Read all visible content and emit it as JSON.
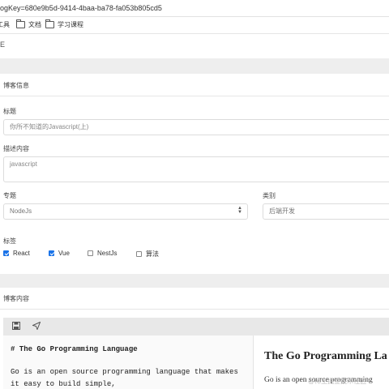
{
  "browser": {
    "url_fragment": "ogKey=680e9b5d-9414-4baa-ba78-fa053b805cd5",
    "bookmarks": [
      {
        "label": "工具",
        "icon": "folder-icon"
      },
      {
        "label": "文档",
        "icon": "folder-icon"
      },
      {
        "label": "学习课程",
        "icon": "folder-icon"
      }
    ]
  },
  "page": {
    "top_label": "E"
  },
  "form": {
    "section_title": "博客信息",
    "title_label": "标题",
    "title_value": "你所不知道的Javascript(上)",
    "desc_label": "描述内容",
    "desc_value": "javascript",
    "topic_label": "专题",
    "topic_value": "NodeJs",
    "category_label": "类别",
    "category_placeholder": "后端开发",
    "tags_label": "标签",
    "tags": [
      {
        "label": "React",
        "checked": true
      },
      {
        "label": "Vue",
        "checked": true
      },
      {
        "label": "NestJs",
        "checked": false
      },
      {
        "label": "算法",
        "checked": false
      }
    ]
  },
  "content": {
    "section_title": "博客内容",
    "toolbar": [
      {
        "icon": "save-icon"
      },
      {
        "icon": "send-icon"
      }
    ],
    "markdown_lines": [
      "# The Go Programming Language",
      "",
      "Go is an open source programming language that makes",
      "it easy to build simple,"
    ],
    "preview_heading": "The Go Programming La",
    "preview_paragraph": "Go is an open source programming"
  },
  "watermark": "@稀土掘金技术社区",
  "colors": {
    "accent": "#1a73e8",
    "band": "#eeeeee"
  }
}
